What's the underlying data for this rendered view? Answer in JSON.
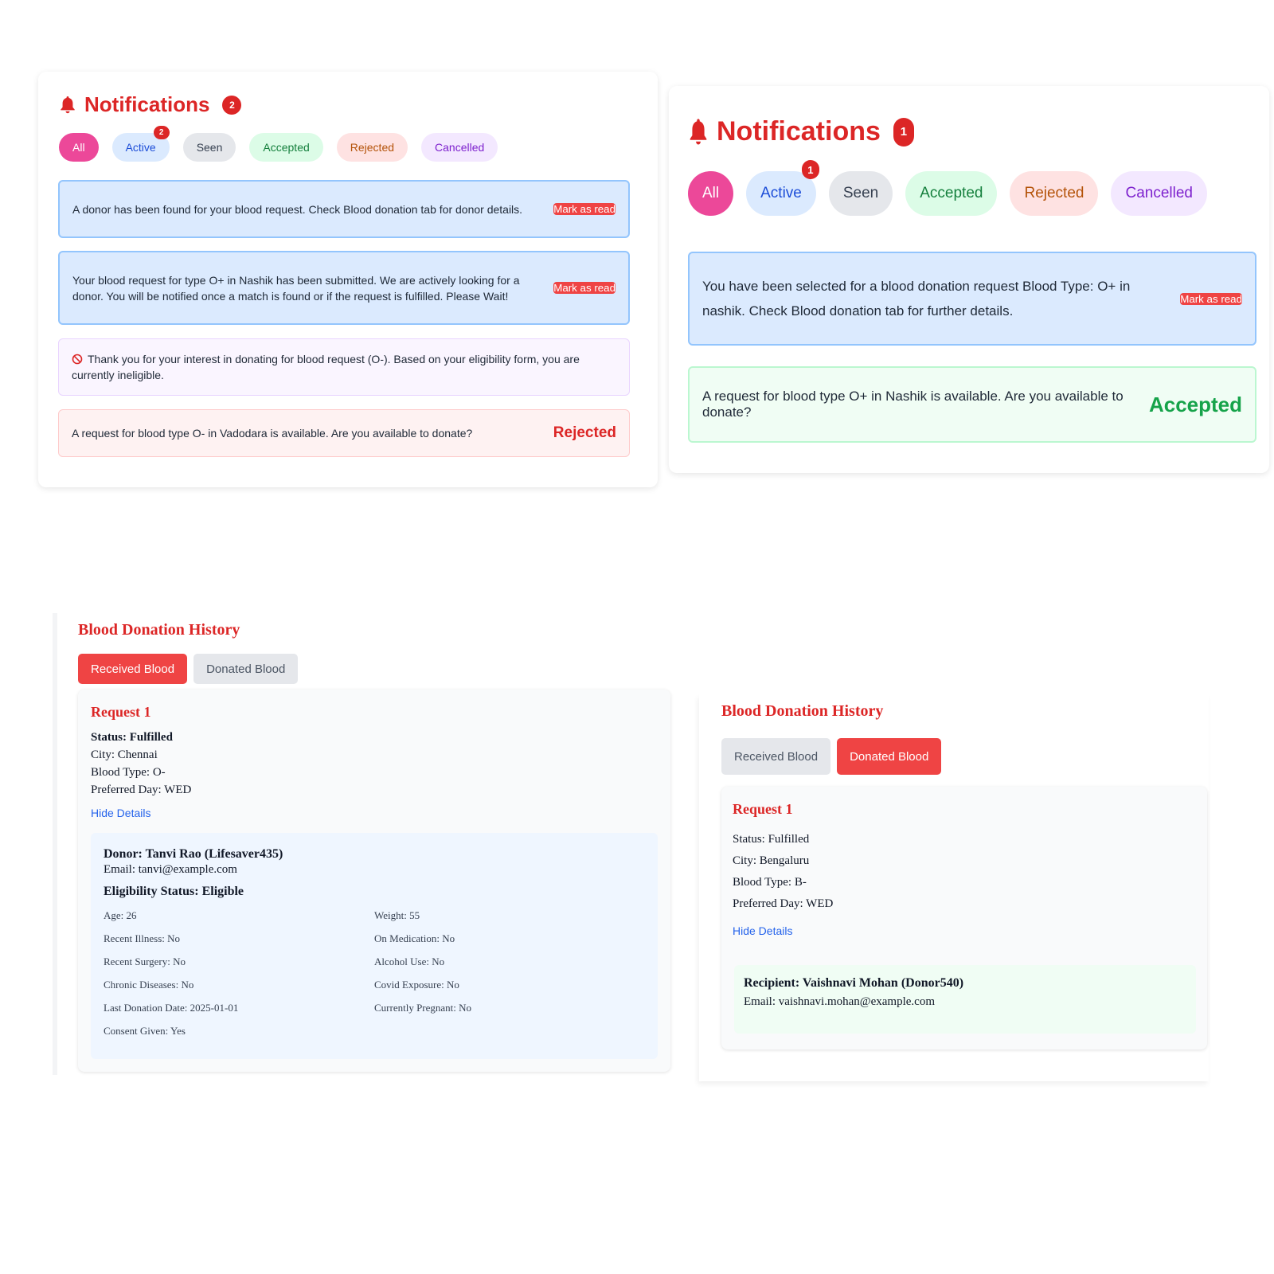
{
  "notifications_left": {
    "title": "Notifications",
    "count": "2",
    "filters": [
      {
        "label": "All",
        "badge": ""
      },
      {
        "label": "Active",
        "badge": "2"
      },
      {
        "label": "Seen",
        "badge": ""
      },
      {
        "label": "Accepted",
        "badge": ""
      },
      {
        "label": "Rejected",
        "badge": ""
      },
      {
        "label": "Cancelled",
        "badge": ""
      }
    ],
    "items": [
      {
        "message": "A donor has been found for your blood request. Check Blood donation tab for donor details.",
        "action": "Mark as read"
      },
      {
        "message": "Your blood request for type O+ in Nashik has been submitted. We are actively looking for a donor. You will be notified once a match is found or if the request is fulfilled. Please Wait!",
        "action": "Mark as read"
      },
      {
        "message": "Thank you for your interest in donating for blood request (O-). Based on your eligibility form, you are currently ineligible.",
        "icon": "block-icon"
      },
      {
        "message": "A request for blood type O- in Vadodara is available. Are you available to donate?",
        "status": "Rejected"
      }
    ]
  },
  "notifications_right": {
    "title": "Notifications",
    "count": "1",
    "filters": [
      {
        "label": "All",
        "badge": ""
      },
      {
        "label": "Active",
        "badge": "1"
      },
      {
        "label": "Seen",
        "badge": ""
      },
      {
        "label": "Accepted",
        "badge": ""
      },
      {
        "label": "Rejected",
        "badge": ""
      },
      {
        "label": "Cancelled",
        "badge": ""
      }
    ],
    "items": [
      {
        "message": "You have been selected for a blood donation request Blood Type: O+ in nashik. Check Blood donation tab for further details.",
        "action": "Mark as read"
      },
      {
        "message": "A request for blood type O+ in Nashik is available. Are you available to donate?",
        "status": "Accepted"
      }
    ]
  },
  "history_left": {
    "title": "Blood Donation History",
    "tabs": [
      "Received Blood",
      "Donated Blood"
    ],
    "active_tab": "Received Blood",
    "request": {
      "title": "Request 1",
      "status": "Status: Fulfilled",
      "city": "City: Chennai",
      "blood_type": "Blood Type: O-",
      "preferred_day": "Preferred Day: WED",
      "hide_details": "Hide Details"
    },
    "donor": {
      "name": "Donor: Tanvi Rao (Lifesaver435)",
      "email": "Email: tanvi@example.com",
      "eligibility": "Eligibility Status: Eligible",
      "fields": [
        "Age: 26",
        "Weight: 55",
        "Recent Illness: No",
        "On Medication: No",
        "Recent Surgery: No",
        "Alcohol Use: No",
        "Chronic Diseases: No",
        "Covid Exposure: No",
        "Last Donation Date: 2025-01-01",
        "Currently Pregnant: No",
        "Consent Given: Yes"
      ]
    }
  },
  "history_right": {
    "title": "Blood Donation History",
    "tabs": [
      "Received Blood",
      "Donated Blood"
    ],
    "active_tab": "Donated Blood",
    "request": {
      "title": "Request 1",
      "status": "Status: Fulfilled",
      "city": "City: Bengaluru",
      "blood_type": "Blood Type: B-",
      "preferred_day": "Preferred Day: WED",
      "hide_details": "Hide Details"
    },
    "recipient": {
      "name": "Recipient: Vaishnavi Mohan (Donor540)",
      "email": "Email: vaishnavi.mohan@example.com"
    }
  },
  "colors": {
    "accent_red": "#dc2626",
    "button_red": "#ef4444",
    "pink_all": "#ec4899",
    "accepted_green": "#16a34a"
  }
}
